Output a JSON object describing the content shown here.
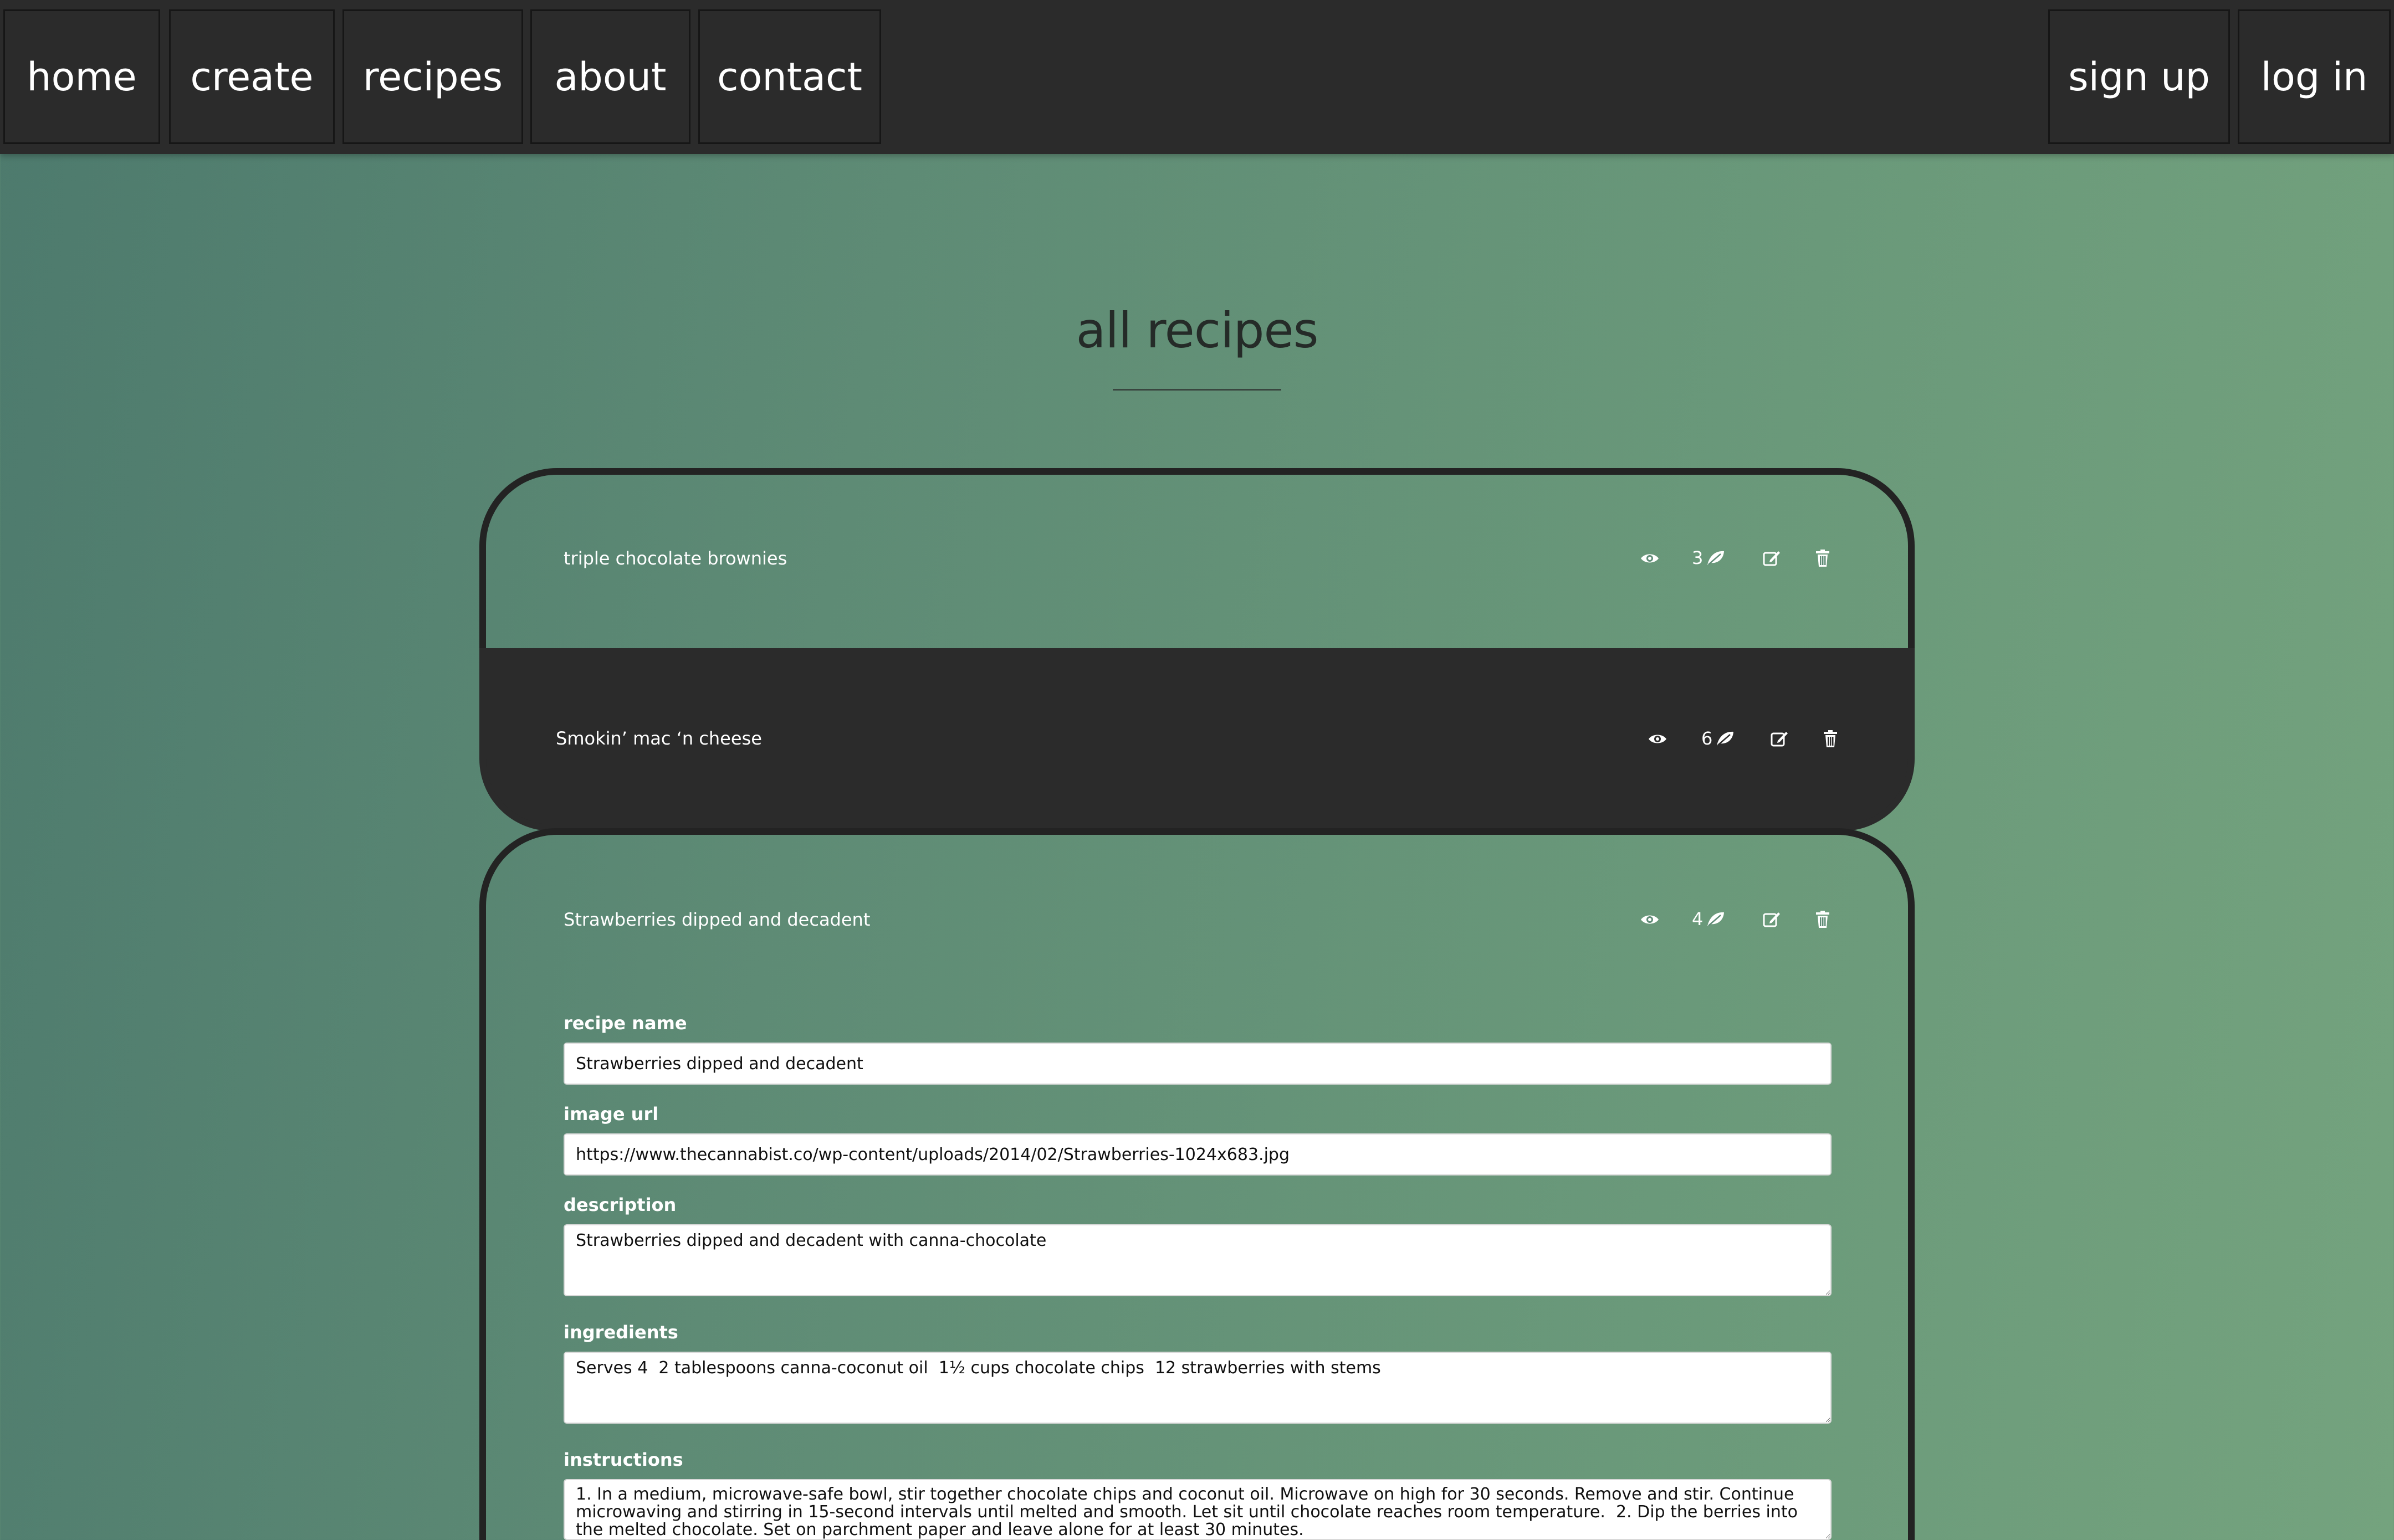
{
  "nav": {
    "left": [
      "home",
      "create",
      "recipes",
      "about",
      "contact"
    ],
    "right": [
      "sign up",
      "log in"
    ]
  },
  "page": {
    "title": "all recipes"
  },
  "recipes": [
    {
      "name": "triple chocolate brownies",
      "count": "3"
    },
    {
      "name": "Smokin’ mac ‘n cheese",
      "count": "6"
    },
    {
      "name": "Strawberries dipped and decadent",
      "count": "4"
    }
  ],
  "icons": {
    "view": "eye-icon",
    "leaf": "leaf-icon",
    "edit": "edit-icon",
    "delete": "trash-icon"
  },
  "form": {
    "recipe_name_label": "recipe name",
    "recipe_name_value": "Strawberries dipped and decadent",
    "image_url_label": "image url",
    "image_url_value": "https://www.thecannabist.co/wp-content/uploads/2014/02/Strawberries-1024x683.jpg",
    "description_label": "description",
    "description_value": "Strawberries dipped and decadent with canna-chocolate",
    "ingredients_label": "ingredients",
    "ingredients_value": "Serves 4  2 tablespoons canna-coconut oil  1½ cups chocolate chips  12 strawberries with stems",
    "instructions_label": "instructions",
    "instructions_value": "1. In a medium, microwave-safe bowl, stir together chocolate chips and coconut oil. Microwave on high for 30 seconds. Remove and stir. Continue microwaving and stirring in 15-second intervals until melted and smooth. Let sit until chocolate reaches room temperature.  2. Dip the berries into the melted chocolate. Set on parchment paper and leave alone for at least 30 minutes."
  },
  "colors": {
    "nav_bg": "#2b2b2b",
    "card_dark": "#2b2b2b",
    "bg_start": "#4d7a6d",
    "bg_end": "#74a37e"
  }
}
